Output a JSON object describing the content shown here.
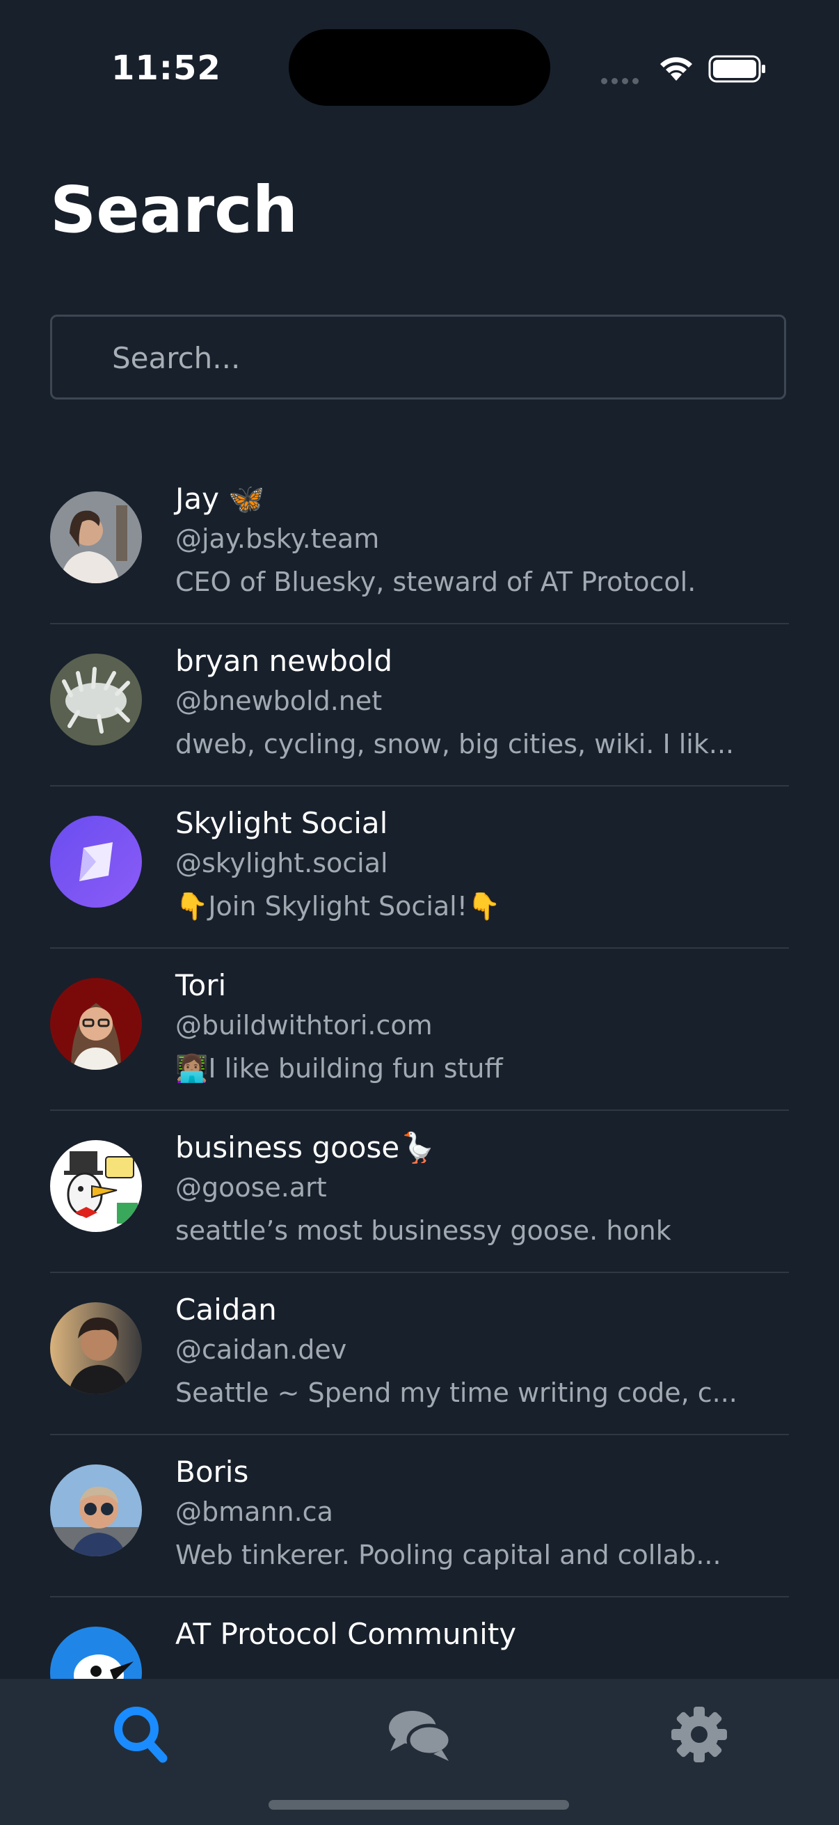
{
  "status_bar": {
    "time": "11:52"
  },
  "header": {
    "title": "Search"
  },
  "search": {
    "placeholder": "Search..."
  },
  "results": [
    {
      "name": "Jay 🦋",
      "handle": "@jay.bsky.team",
      "bio": "CEO of Bluesky, steward of AT Protocol."
    },
    {
      "name": "bryan newbold",
      "handle": "@bnewbold.net",
      "bio": "dweb, cycling, snow, big cities, wiki. I lik..."
    },
    {
      "name": "Skylight Social",
      "handle": "@skylight.social",
      "bio": "👇Join Skylight Social!👇"
    },
    {
      "name": "Tori",
      "handle": "@buildwithtori.com",
      "bio": "👩🏽‍💻I like building fun stuff"
    },
    {
      "name": "business goose🪿",
      "handle": "@goose.art",
      "bio": "seattle’s most businessy goose. honk"
    },
    {
      "name": "Caidan",
      "handle": "@caidan.dev",
      "bio": "Seattle ~ Spend my time writing code, c..."
    },
    {
      "name": "Boris",
      "handle": "@bmann.ca",
      "bio": "Web tinkerer. Pooling capital and collab..."
    },
    {
      "name": "AT Protocol Community",
      "handle": "",
      "bio": ""
    }
  ],
  "tabs": [
    {
      "icon": "search-icon",
      "active": true
    },
    {
      "icon": "chat-icon",
      "active": false
    },
    {
      "icon": "gear-icon",
      "active": false
    }
  ],
  "colors": {
    "background": "#18202b",
    "tabbar": "#232d39",
    "accent": "#1a8cff",
    "muted": "#a2a9b2"
  }
}
